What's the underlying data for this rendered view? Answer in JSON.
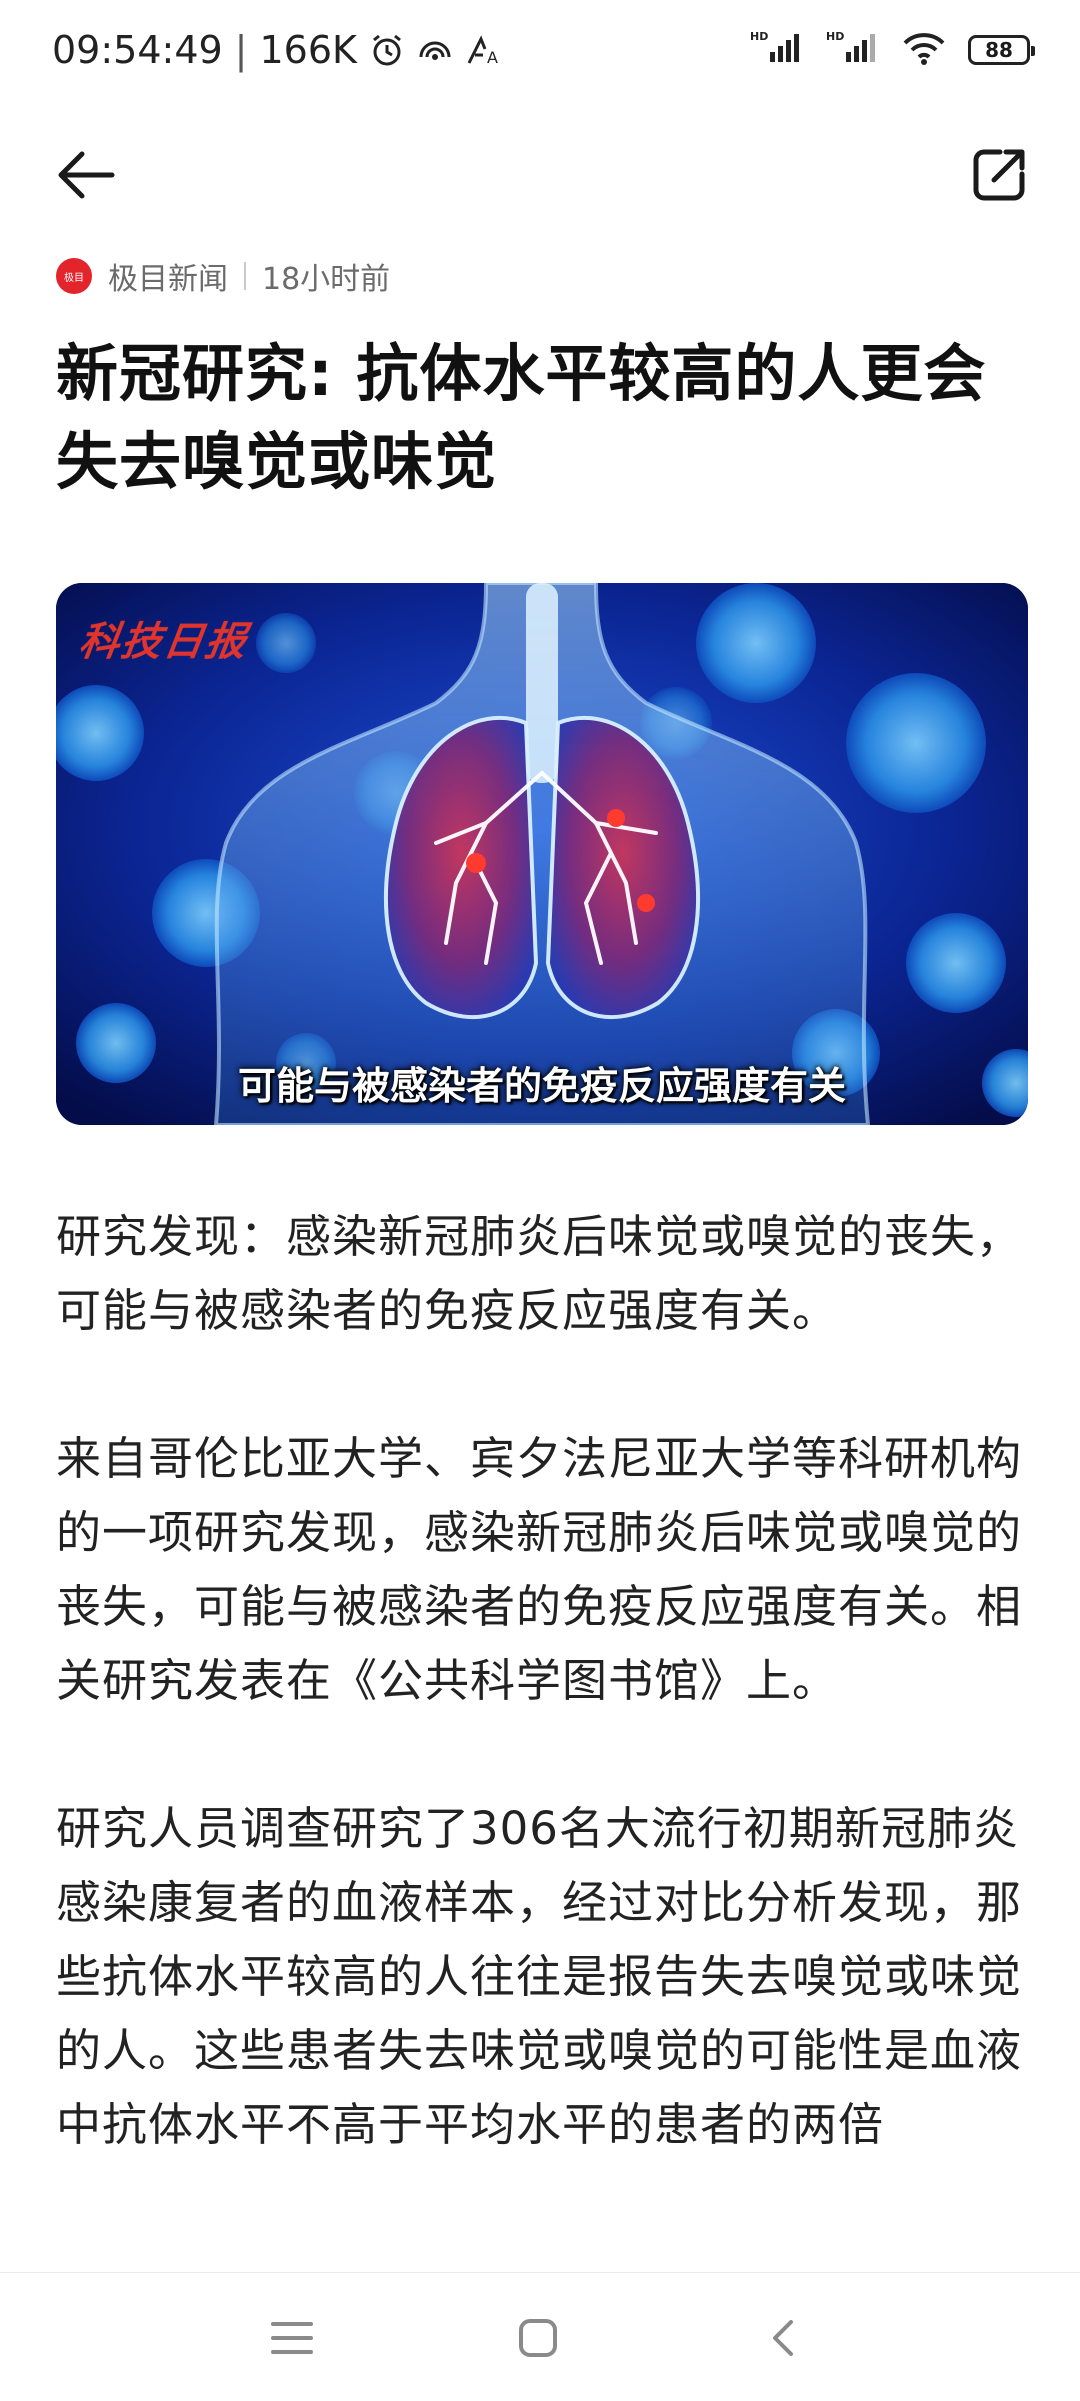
{
  "status_bar": {
    "time": "09:54:49",
    "separator": "|",
    "net_speed": "166K",
    "battery_level": "88",
    "signal_1": "HD",
    "signal_2": "HD",
    "icons": [
      "alarm-icon",
      "hotspot-icon",
      "font-icon",
      "signal-icon",
      "wifi-icon",
      "battery-icon"
    ]
  },
  "nav": {
    "back_icon": "arrow-left-icon",
    "share_icon": "share-icon"
  },
  "article_meta": {
    "source_logo_text": "极目",
    "source": "极目新闻",
    "time_ago": "18小时前"
  },
  "title": "新冠研究: 抗体水平较高的人更会失去嗅觉或味觉",
  "hero": {
    "watermark": "科技日报",
    "caption": "可能与被感染者的免疫反应强度有关"
  },
  "body": {
    "paragraphs": [
      "研究发现：感染新冠肺炎后味觉或嗅觉的丧失，可能与被感染者的免疫反应强度有关。",
      "来自哥伦比亚大学、宾夕法尼亚大学等科研机构的一项研究发现，感染新冠肺炎后味觉或嗅觉的丧失，可能与被感染者的免疫反应强度有关。相关研究发表在《公共科学图书馆》上。",
      "研究人员调查研究了306名大流行初期新冠肺炎感染康复者的血液样本，经过对比分析发现，那些抗体水平较高的人往往是报告失去嗅觉或味觉的人。这些患者失去味觉或嗅觉的可能性是血液中抗体水平不高于平均水平的患者的两倍"
    ]
  },
  "bottom_nav": {
    "icons": [
      "menu-icon",
      "home-icon",
      "back-icon"
    ]
  },
  "colors": {
    "accent_red": "#e3242b",
    "text": "#222222",
    "muted": "#6b6b6b"
  }
}
